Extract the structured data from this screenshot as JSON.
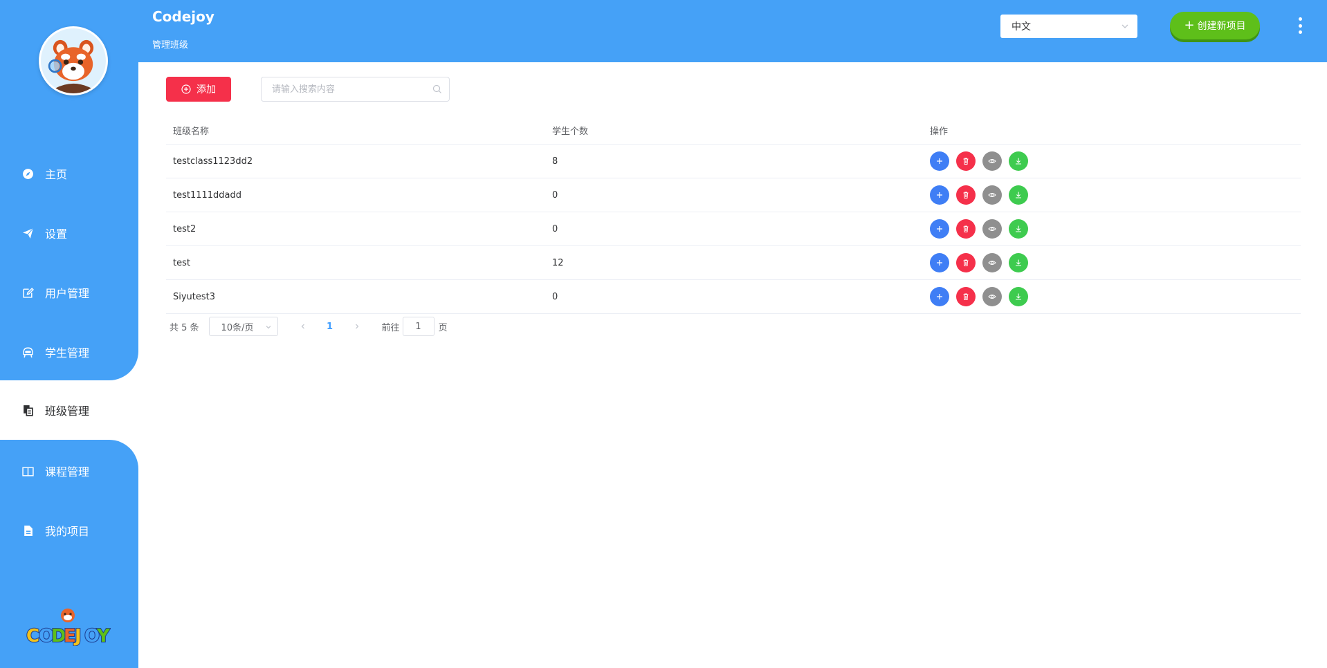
{
  "app": {
    "title": "Codejoy",
    "subtitle": "管理班级"
  },
  "header": {
    "language": "中文",
    "create_label": "创建新项目",
    "more_icon": "more-vertical-icon"
  },
  "sidebar": {
    "items": [
      {
        "label": "主页",
        "icon": "compass-icon",
        "active": false
      },
      {
        "label": "设置",
        "icon": "paper-plane-icon",
        "active": false
      },
      {
        "label": "用户管理",
        "icon": "edit-icon",
        "active": false
      },
      {
        "label": "学生管理",
        "icon": "student-icon",
        "active": false
      },
      {
        "label": "班级管理",
        "icon": "class-icon",
        "active": true
      },
      {
        "label": "课程管理",
        "icon": "book-icon",
        "active": false
      },
      {
        "label": "我的项目",
        "icon": "document-icon",
        "active": false
      }
    ]
  },
  "toolbar": {
    "add_label": "添加",
    "search_placeholder": "请输入搜索内容"
  },
  "table": {
    "columns": [
      "班级名称",
      "学生个数",
      "操作"
    ],
    "rows": [
      {
        "name": "testclass1123dd2",
        "count": "8"
      },
      {
        "name": "test1111ddadd",
        "count": "0"
      },
      {
        "name": "test2",
        "count": "0"
      },
      {
        "name": "test",
        "count": "12"
      },
      {
        "name": "Siyutest3",
        "count": "0"
      }
    ],
    "actions": [
      "add-icon",
      "delete-icon",
      "view-icon",
      "download-icon"
    ]
  },
  "pagination": {
    "total": "共 5 条",
    "page_size": "10条/页",
    "current_page": "1",
    "goto_label": "前往",
    "goto_value": "1",
    "goto_unit": "页"
  },
  "colors": {
    "primary": "#45a1f7",
    "create": "#5ebf1a",
    "danger": "#f5304a",
    "action_add": "#3f7ef5",
    "action_view": "#8f8f8f",
    "action_download": "#3ecb4f"
  }
}
